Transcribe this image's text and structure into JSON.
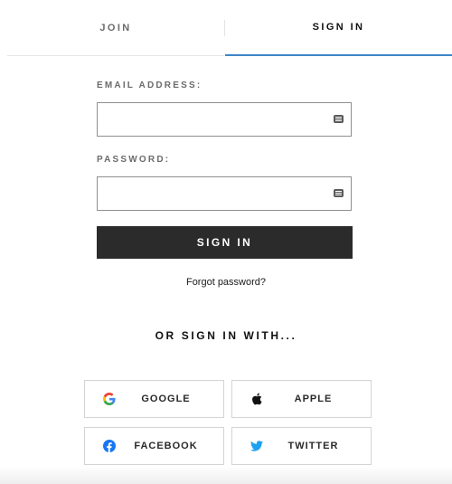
{
  "tabs": {
    "join": "JOIN",
    "signin": "SIGN IN"
  },
  "form": {
    "email_label": "EMAIL ADDRESS:",
    "email_value": "",
    "password_label": "PASSWORD:",
    "password_value": "",
    "submit_label": "SIGN IN",
    "forgot_label": "Forgot password?"
  },
  "social": {
    "heading": "OR SIGN IN WITH...",
    "buttons": [
      {
        "label": "GOOGLE",
        "icon": "google-icon"
      },
      {
        "label": "APPLE",
        "icon": "apple-icon"
      },
      {
        "label": "FACEBOOK",
        "icon": "facebook-icon"
      },
      {
        "label": "TWITTER",
        "icon": "twitter-icon"
      }
    ]
  },
  "colors": {
    "accent": "#3d86c6",
    "button_bg": "#2b2b2b",
    "google_blue": "#4285f4",
    "google_red": "#ea4335",
    "google_yellow": "#fbbc05",
    "google_green": "#34a853",
    "facebook": "#1877f2",
    "twitter": "#1da1f2"
  }
}
